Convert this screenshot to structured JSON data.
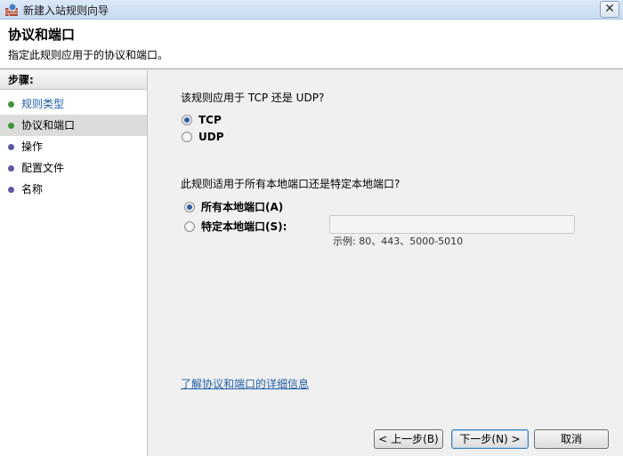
{
  "window": {
    "title": "新建入站规则向导",
    "close_glyph": "✕"
  },
  "header": {
    "title": "协议和端口",
    "subtitle": "指定此规则应用于的协议和端口。"
  },
  "steps": {
    "title": "步骤:",
    "items": [
      {
        "label": "规则类型",
        "state": "done"
      },
      {
        "label": "协议和端口",
        "state": "current"
      },
      {
        "label": "操作",
        "state": "todo"
      },
      {
        "label": "配置文件",
        "state": "todo"
      },
      {
        "label": "名称",
        "state": "todo"
      }
    ]
  },
  "protocol": {
    "question": "该规则应用于 TCP 还是 UDP?",
    "options": [
      {
        "label": "TCP",
        "checked": true
      },
      {
        "label": "UDP",
        "checked": false
      }
    ]
  },
  "ports": {
    "question": "此规则适用于所有本地端口还是特定本地端口?",
    "options": [
      {
        "label": "所有本地端口(A)",
        "checked": true
      },
      {
        "label": "特定本地端口(S):",
        "checked": false
      }
    ],
    "input_value": "",
    "example": "示例: 80、443、5000-5010"
  },
  "link": {
    "label": "了解协议和端口的详细信息"
  },
  "buttons": {
    "back": "< 上一步(B)",
    "next": "下一步(N) >",
    "cancel": "取消"
  },
  "colors": {
    "link": "#1f5fa8",
    "done_dot": "#3a9a3a",
    "todo_dot": "#5b57a6"
  }
}
